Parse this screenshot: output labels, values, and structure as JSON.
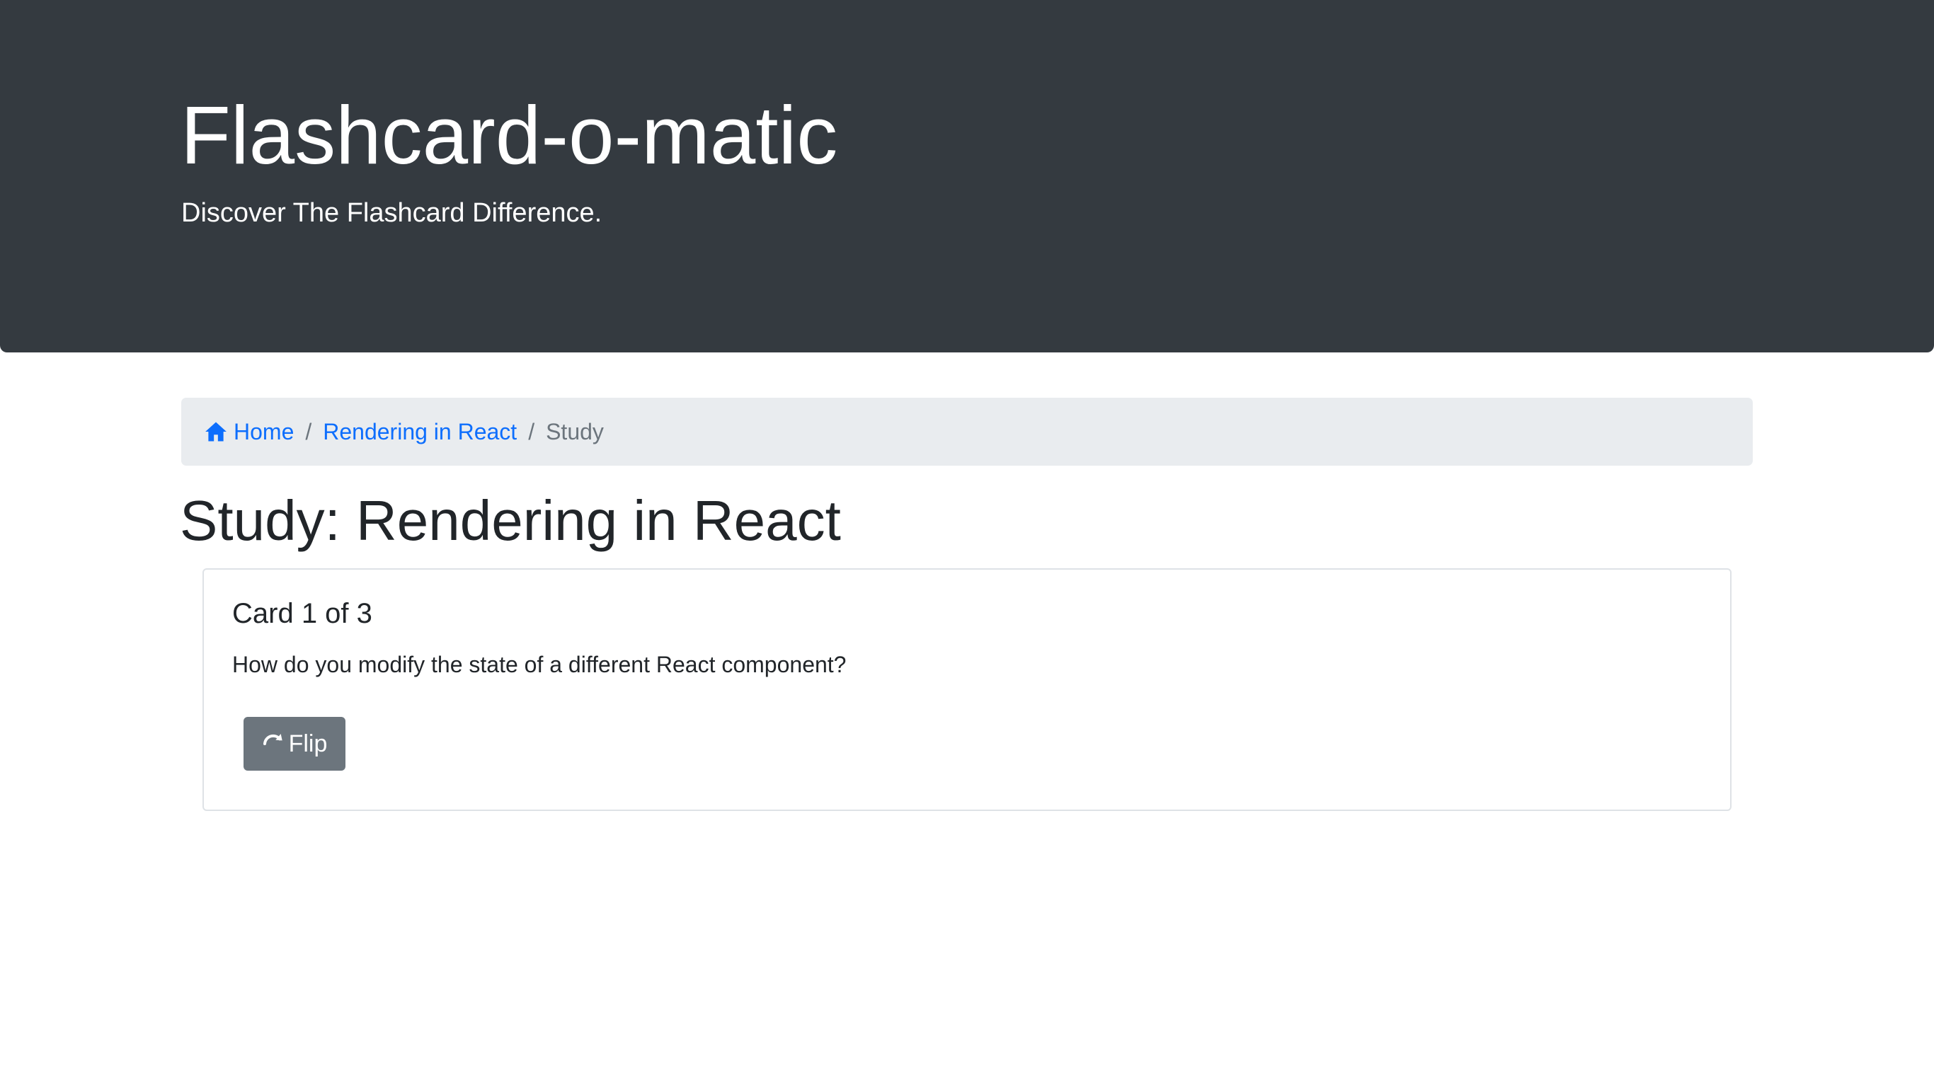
{
  "header": {
    "title": "Flashcard-o-matic",
    "tagline": "Discover The Flashcard Difference."
  },
  "breadcrumb": {
    "home_label": "Home",
    "home_icon": "home-icon",
    "deck_label": "Rendering in React",
    "separator": "/",
    "current_label": "Study"
  },
  "page": {
    "title": "Study: Rendering in React"
  },
  "card": {
    "title": "Card 1 of 3",
    "front_text": "How do you modify the state of a different React component?",
    "flip_label": "Flip",
    "flip_icon": "flip-arrow-icon"
  },
  "colors": {
    "header_bg": "#343a40",
    "link": "#0d6efd",
    "breadcrumb_bg": "#e9ecef",
    "button_bg": "#6c757d"
  }
}
